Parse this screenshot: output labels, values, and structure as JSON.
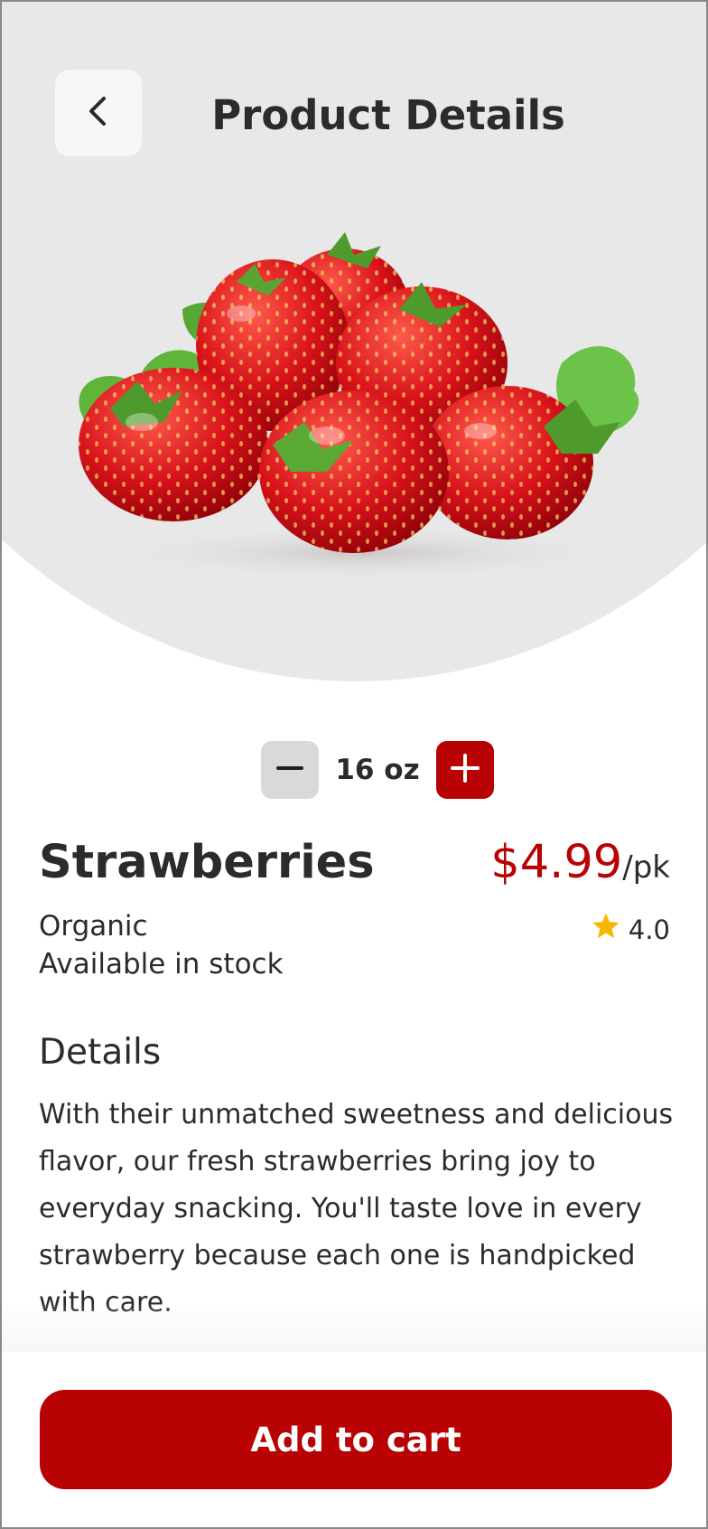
{
  "header": {
    "title": "Product Details",
    "back_icon": "chevron-left-icon"
  },
  "product": {
    "image": "strawberries-photo",
    "name": "Strawberries",
    "price": "$4.99",
    "unit": "/pk",
    "tag": "Organic",
    "availability": "Available in stock",
    "rating": "4.0",
    "rating_icon": "star-icon"
  },
  "quantity": {
    "value": "16 oz",
    "decrease_icon": "minus-icon",
    "increase_icon": "plus-icon"
  },
  "details": {
    "heading": "Details",
    "text": "With their unmatched sweetness and delicious flavor, our fresh strawberries bring joy to everyday snacking. You'll taste love in every strawberry because each one is handpicked with care."
  },
  "cart": {
    "button_label": "Add to cart"
  },
  "colors": {
    "accent": "#B80204",
    "hero_background": "#E8E8E8",
    "star": "#F5B800",
    "text": "#2B2B2B"
  }
}
